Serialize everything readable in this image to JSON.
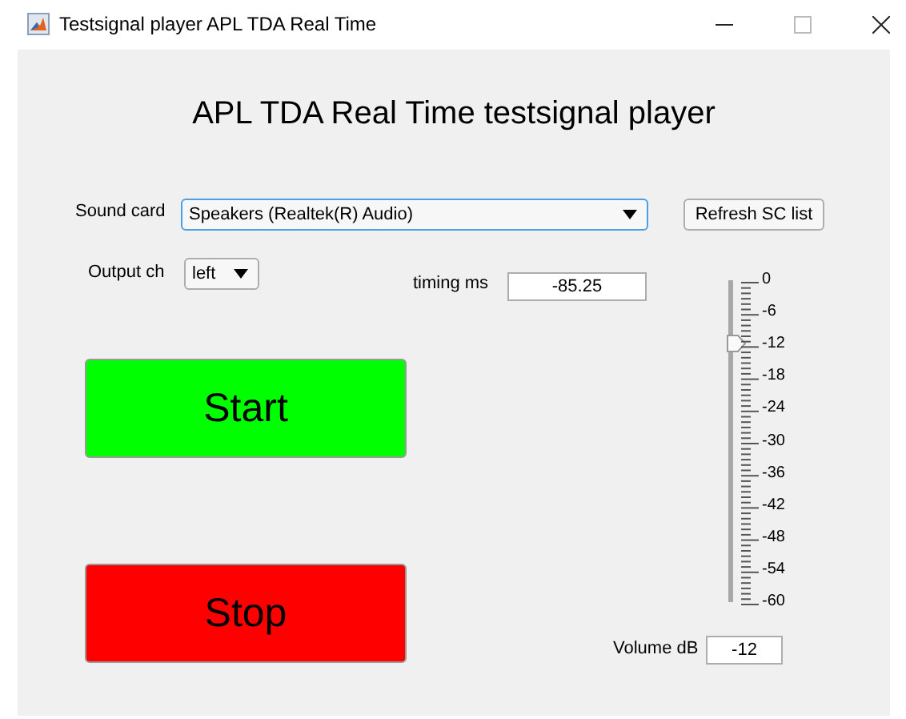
{
  "window": {
    "title": "Testsignal player APL TDA Real Time"
  },
  "heading": "APL TDA Real Time testsignal player",
  "sound_card": {
    "label": "Sound card",
    "value": "Speakers (Realtek(R) Audio)"
  },
  "refresh_button": "Refresh SC list",
  "output_ch": {
    "label": "Output ch",
    "value": "left"
  },
  "timing": {
    "label": "timing ms",
    "value": "-85.25"
  },
  "start_button": "Start",
  "stop_button": "Stop",
  "volume_slider": {
    "level": 0.8,
    "ticks": [
      "0",
      "-6",
      "-12",
      "-18",
      "-24",
      "-30",
      "-36",
      "-42",
      "-48",
      "-54",
      "-60"
    ]
  },
  "volume": {
    "label": "Volume dB",
    "value": "-12"
  }
}
